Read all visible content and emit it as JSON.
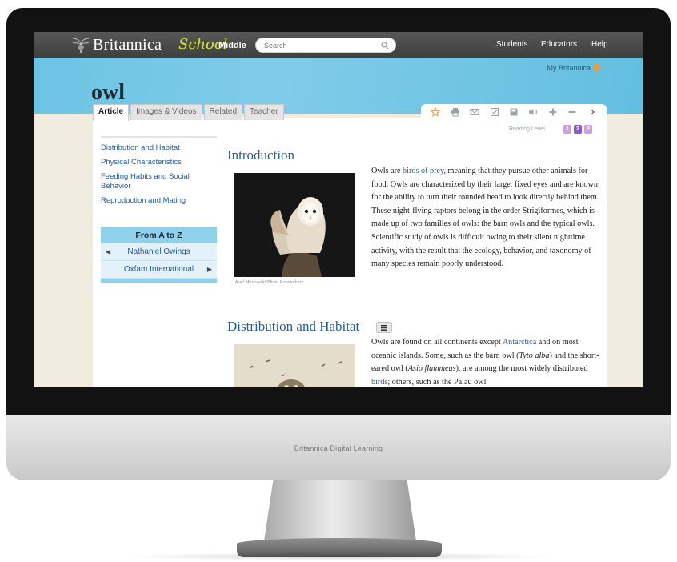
{
  "header": {
    "brand": "Britannica",
    "brand_school": "School",
    "level": "Middle",
    "search_placeholder": "Search",
    "links": [
      "Students",
      "Educators",
      "Help"
    ],
    "my_britannica": "My Britannica"
  },
  "article": {
    "title": "owl",
    "tabs": [
      "Article",
      "Images & Videos",
      "Related",
      "Teacher"
    ],
    "reading_levels_label": "Reading Level",
    "reading_levels": [
      "1",
      "2",
      "3"
    ],
    "active_level": "2"
  },
  "toc": {
    "items": [
      "Distribution and Habitat",
      "Physical Characteristics",
      "Feeding Habits and Social Behavior",
      "Reproduction and Mating"
    ]
  },
  "atoz": {
    "title": "From A to Z",
    "prev": "Nathaniel Owings",
    "next": "Oxfam International"
  },
  "intro": {
    "heading": "Introduction",
    "photo_credit": "Karl Maslowski/Photo Researchers",
    "p1_a": "Owls are",
    "p1_link1": "birds of prey",
    "p1_b": ", meaning that they pursue other animals for food. Owls are characterized by their large, fixed eyes and are known for the ability to turn their rounded head to look directly behind them. These night-flying raptors belong in the order Strigiformes, which is made up of two families of owls: the barn owls and the typical owls. Scientific study of owls is difficult owing to their silent nighttime activity, with the result that the ecology, behavior, and taxonomy of many species remain poorly understood."
  },
  "distribution": {
    "heading": "Distribution and Habitat",
    "t1": "Owls are found on all continents except",
    "link_antarctica": "Antarctica",
    "t2": "and on most oceanic islands. Some, such as the barn owl (",
    "tyto": "Tyto alba",
    "t3": ") and the short-eared owl (",
    "asio": "Asio flammeus",
    "t4": "), are among the most widely distributed",
    "link_birds": "birds",
    "t5": "; others, such as the Palau owl"
  },
  "device": {
    "chin_label": "Britannica Digital Learning"
  },
  "colors": {
    "hero": "#7fcce9",
    "link": "#2a5d92",
    "topbar": "#4a4a4a",
    "level_active": "#8f5cc7"
  },
  "icons": [
    "star-icon",
    "print-icon",
    "email-icon",
    "checklist-icon",
    "save-icon",
    "audio-icon",
    "zoom-in-icon",
    "zoom-out-icon",
    "chevron-right-icon"
  ]
}
